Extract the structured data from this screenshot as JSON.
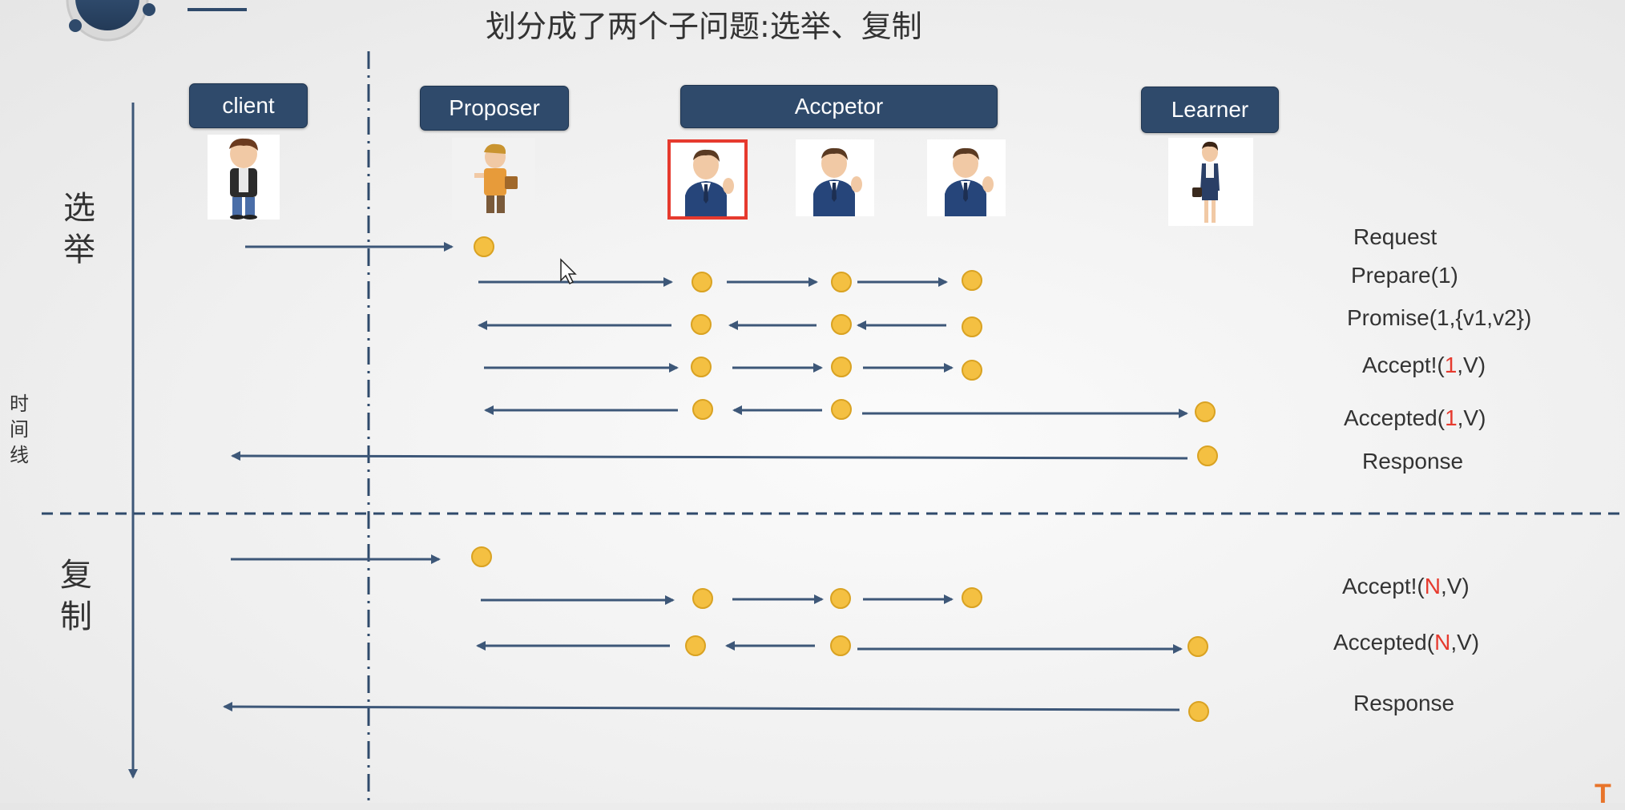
{
  "title": "划分成了两个子问题:选举、复制",
  "roles": {
    "client": "client",
    "proposer": "Proposer",
    "acceptor": "Accpetor",
    "learner": "Learner"
  },
  "phases": {
    "election": [
      "选",
      "举"
    ],
    "replication": [
      "复",
      "制"
    ]
  },
  "timeline_label": [
    "时",
    "间",
    "线"
  ],
  "messages": {
    "request": "Request",
    "prepare": "Prepare(1)",
    "promise": "Promise(1,{v1,v2})",
    "accept1_pre": "Accept!(",
    "accept1_num": "1",
    "accept1_post": ",V)",
    "accepted1_pre": "Accepted(",
    "accepted1_num": "1",
    "accepted1_post": ",V)",
    "response1": "Response",
    "acceptN_pre": "Accept!(",
    "acceptN_num": "N",
    "acceptN_post": ",V)",
    "acceptedN_pre": "Accepted(",
    "acceptedN_num": "N",
    "acceptedN_post": ",V)",
    "response2": "Response"
  },
  "logo_fragment": "T",
  "colors": {
    "role_box": "#2f4a6b",
    "arrow": "#3d5778",
    "node": "#f4c042",
    "highlight": "#e63a2e"
  },
  "icons": {
    "client": "boy-avatar",
    "proposer": "worker-avatar",
    "acceptor": "businessman-avatar",
    "learner": "businesswoman-avatar"
  }
}
